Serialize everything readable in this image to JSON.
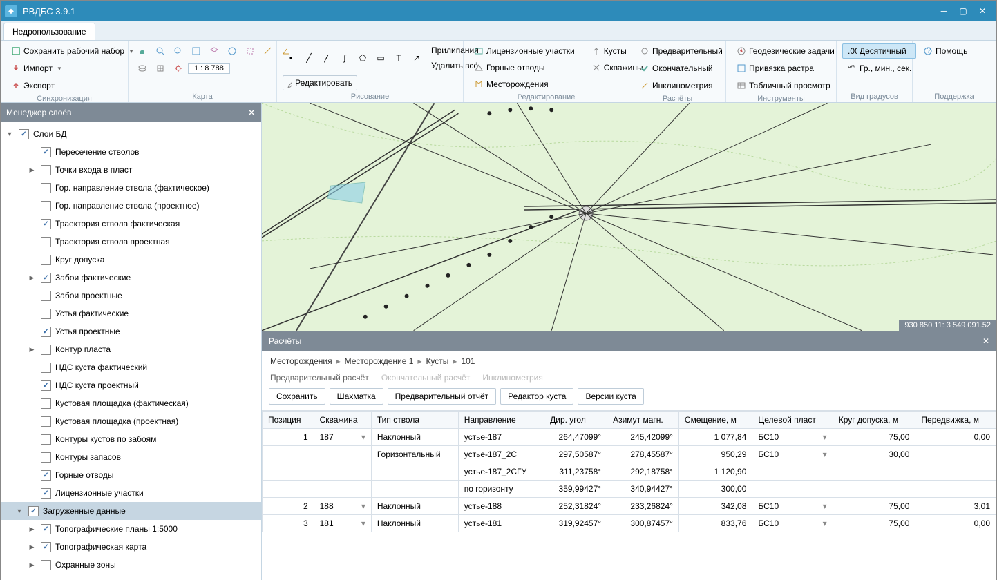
{
  "app": {
    "title": "РВДБС 3.9.1"
  },
  "ribbon_tab": "Недропользование",
  "sync": {
    "save": "Сохранить рабочий набор",
    "import": "Импорт",
    "export": "Экспорт",
    "label": "Синхронизация"
  },
  "map_group": {
    "scale": "1 : 8 788",
    "label": "Карта"
  },
  "draw": {
    "snap": "Прилипания",
    "delete_all": "Удалить всё",
    "edit": "Редактировать",
    "label": "Рисование"
  },
  "edit": {
    "license": "Лицензионные участки",
    "bushes": "Кусты",
    "mining": "Горные отводы",
    "wells": "Скважины",
    "fields": "Месторождения",
    "label": "Редактирование"
  },
  "calc_ribbon": {
    "pre": "Предварительный",
    "final": "Окончательный",
    "incl": "Инклинометрия",
    "label": "Расчёты"
  },
  "tools": {
    "geo": "Геодезические задачи",
    "raster": "Привязка растра",
    "tabview": "Табличный просмотр",
    "label": "Инструменты"
  },
  "degview": {
    "dec": "Десятичный",
    "dms": "Гр., мин., сек.",
    "label": "Вид градусов"
  },
  "support": {
    "help": "Помощь",
    "label": "Поддержка"
  },
  "layers": {
    "title": "Менеджер слоёв",
    "root": "Слои БД",
    "items": [
      {
        "label": "Пересечение стволов",
        "checked": true,
        "indent": 2
      },
      {
        "label": "Точки входа в пласт",
        "checked": false,
        "indent": 2,
        "expander": "▶"
      },
      {
        "label": "Гор. направление ствола (фактическое)",
        "checked": false,
        "indent": 2
      },
      {
        "label": "Гор. направление ствола (проектное)",
        "checked": false,
        "indent": 2
      },
      {
        "label": "Траектория ствола фактическая",
        "checked": true,
        "indent": 2
      },
      {
        "label": "Траектория ствола проектная",
        "checked": false,
        "indent": 2
      },
      {
        "label": "Круг допуска",
        "checked": false,
        "indent": 2
      },
      {
        "label": "Забои фактические",
        "checked": true,
        "indent": 2,
        "expander": "▶"
      },
      {
        "label": "Забои проектные",
        "checked": false,
        "indent": 2
      },
      {
        "label": "Устья фактические",
        "checked": false,
        "indent": 2
      },
      {
        "label": "Устья проектные",
        "checked": true,
        "indent": 2
      },
      {
        "label": "Контур пласта",
        "checked": false,
        "indent": 2,
        "expander": "▶"
      },
      {
        "label": "НДС куста фактический",
        "checked": false,
        "indent": 2
      },
      {
        "label": "НДС куста проектный",
        "checked": true,
        "indent": 2
      },
      {
        "label": "Кустовая площадка (фактическая)",
        "checked": false,
        "indent": 2
      },
      {
        "label": "Кустовая площадка (проектная)",
        "checked": false,
        "indent": 2
      },
      {
        "label": "Контуры кустов по забоям",
        "checked": false,
        "indent": 2
      },
      {
        "label": "Контуры запасов",
        "checked": false,
        "indent": 2
      },
      {
        "label": "Горные отводы",
        "checked": true,
        "indent": 2
      },
      {
        "label": "Лицензионные участки",
        "checked": true,
        "indent": 2
      }
    ],
    "loaded": {
      "label": "Загруженные данные",
      "checked": true,
      "indent": 1,
      "expander": "▼",
      "selected": true
    },
    "sub": [
      {
        "label": "Топографические планы 1:5000",
        "checked": true,
        "indent": 2,
        "expander": "▶"
      },
      {
        "label": "Топографическая карта",
        "checked": true,
        "indent": 2,
        "expander": "▶"
      },
      {
        "label": "Охранные зоны",
        "checked": false,
        "indent": 2,
        "expander": "▶"
      }
    ]
  },
  "coords": "930 850.11: 3 549 091.52",
  "calc": {
    "title": "Расчёты",
    "breadcrumb": [
      "Месторождения",
      "Месторождение 1",
      "Кусты",
      "101"
    ],
    "tabs": {
      "pre": "Предварительный расчёт",
      "final": "Окончательный расчёт",
      "incl": "Инклинометрия"
    },
    "buttons": {
      "save": "Сохранить",
      "chess": "Шахматка",
      "report": "Предварительный отчёт",
      "editor": "Редактор куста",
      "versions": "Версии куста"
    },
    "columns": [
      "Позиция",
      "Скважина",
      "Тип ствола",
      "Направление",
      "Дир. угол",
      "Азимут магн.",
      "Смещение, м",
      "Целевой пласт",
      "Круг допуска, м",
      "Передвижка, м"
    ],
    "rows": [
      {
        "pos": "1",
        "well": "187",
        "type": "Наклонный",
        "dir": "устье-187",
        "dang": "264,47099°",
        "az": "245,42099°",
        "off": "1 077,84",
        "layer": "БС10",
        "circle": "75,00",
        "shift": "0,00"
      },
      {
        "pos": "",
        "well": "",
        "type": "Горизонтальный",
        "dir": "устье-187_2С",
        "dang": "297,50587°",
        "az": "278,45587°",
        "off": "950,29",
        "layer": "БС10",
        "circle": "30,00",
        "shift": ""
      },
      {
        "pos": "",
        "well": "",
        "type": "",
        "dir": "устье-187_2СГУ",
        "dang": "311,23758°",
        "az": "292,18758°",
        "off": "1 120,90",
        "layer": "",
        "circle": "",
        "shift": ""
      },
      {
        "pos": "",
        "well": "",
        "type": "",
        "dir": "по горизонту",
        "dang": "359,99427°",
        "az": "340,94427°",
        "off": "300,00",
        "layer": "",
        "circle": "",
        "shift": ""
      },
      {
        "pos": "2",
        "well": "188",
        "type": "Наклонный",
        "dir": "устье-188",
        "dang": "252,31824°",
        "az": "233,26824°",
        "off": "342,08",
        "layer": "БС10",
        "circle": "75,00",
        "shift": "3,01"
      },
      {
        "pos": "3",
        "well": "181",
        "type": "Наклонный",
        "dir": "устье-181",
        "dang": "319,92457°",
        "az": "300,87457°",
        "off": "833,76",
        "layer": "БС10",
        "circle": "75,00",
        "shift": "0,00"
      }
    ]
  }
}
